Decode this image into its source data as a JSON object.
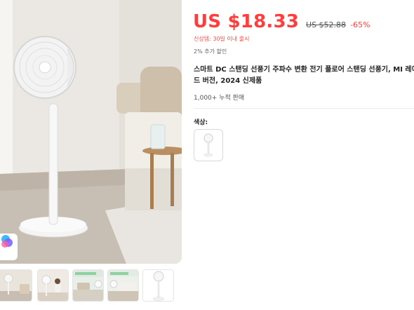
{
  "price": {
    "current": "US $18.33",
    "original": "US $52.88",
    "discount": "-65%"
  },
  "promotions": {
    "new_user_note": "신상템: 30일 이내 출시",
    "extra_discount": "2% 추가 할인"
  },
  "product": {
    "title": "스마트 DC 스탠딩 선풍기 주파수 변환 전기 플로어 스탠딩 선풍기, MI 레이드 버전, 2024 신제품",
    "sold_count": "1,000+ 누적 판매"
  },
  "variants": {
    "label": "색상:",
    "options": [
      "white-standing-fan"
    ]
  },
  "thumbnails": [
    "living-room-scene",
    "woman-with-fan",
    "family-room-scene",
    "sofa-scene",
    "fan-product-shot"
  ],
  "icons": {
    "brand_badge": "brand-logo-icon"
  },
  "colors": {
    "price": "#ff3d3d",
    "text": "#222222"
  }
}
